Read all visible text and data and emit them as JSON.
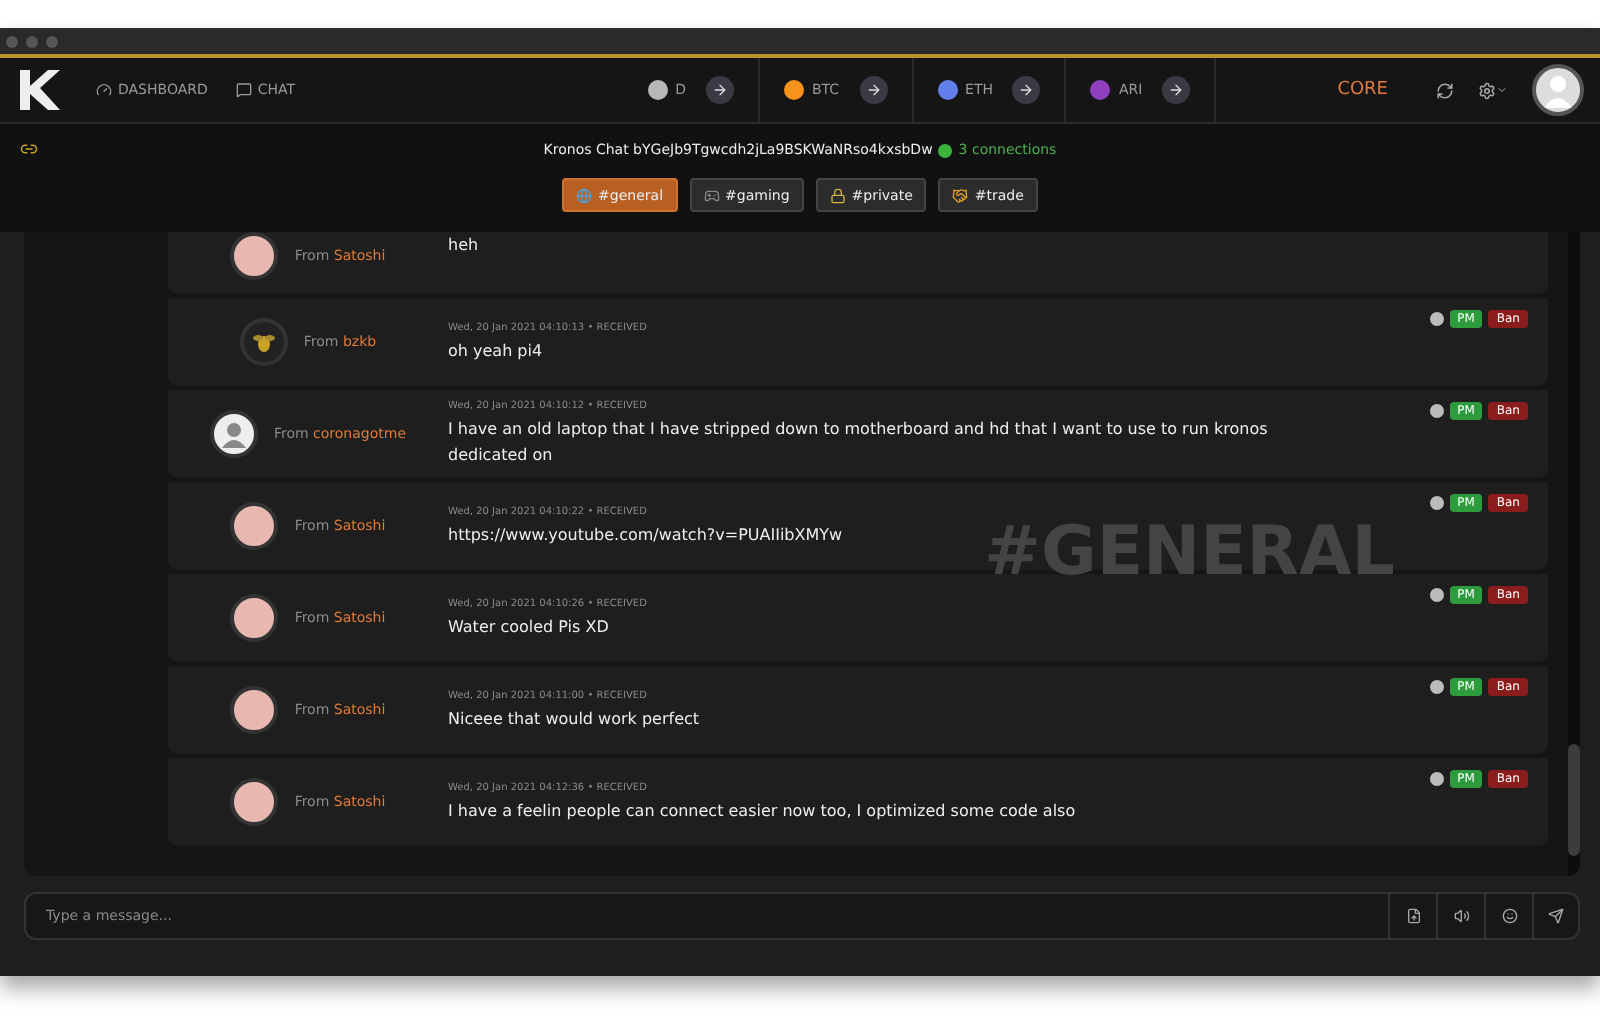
{
  "nav": {
    "links": [
      {
        "label": "DASHBOARD",
        "kind": "dashboard"
      },
      {
        "label": "CHAT",
        "kind": "chat"
      }
    ],
    "coins": [
      {
        "label": "D",
        "color": "#b8b8b8"
      },
      {
        "label": "BTC",
        "color": "#f7931a"
      },
      {
        "label": "ETH",
        "color": "#627eea"
      },
      {
        "label": "ARI",
        "color": "#8e3fc0"
      }
    ],
    "core": "CORE"
  },
  "chat": {
    "title": "Kronos Chat bYGeJb9Tgwcdh2jLa9BSKWaNRso4kxsbDw",
    "connections": "3 connections",
    "online": true,
    "channels": [
      {
        "label": "#general",
        "kind": "globe",
        "selected": true
      },
      {
        "label": "#gaming",
        "kind": "gamepad",
        "selected": false
      },
      {
        "label": "#private",
        "kind": "lock",
        "selected": false
      },
      {
        "label": "#trade",
        "kind": "handshake",
        "selected": false
      }
    ],
    "background_label": "#GENERAL",
    "messages": [
      {
        "from_label": "From",
        "sender": "Satoshi",
        "kind": "photo",
        "text": "heh"
      },
      {
        "from_label": "From",
        "sender": "bzkb",
        "kind": "bee",
        "time": "Wed, 20 Jan 2021 04:10:13 • RECEIVED",
        "text": "oh yeah pi4",
        "actions": [
          "PM",
          "Ban"
        ]
      },
      {
        "from_label": "From",
        "sender": "coronagotme",
        "kind": "silhouette",
        "time": "Wed, 20 Jan 2021 04:10:12 • RECEIVED",
        "text": "I have an old laptop that I have stripped down to motherboard and hd that I want to use to run kronos dedicated on",
        "actions": [
          "PM",
          "Ban"
        ]
      },
      {
        "from_label": "From",
        "sender": "Satoshi",
        "kind": "photo",
        "time": "Wed, 20 Jan 2021 04:10:22 • RECEIVED",
        "text": "https://www.youtube.com/watch?v=PUAIIibXMYw",
        "actions": [
          "PM",
          "Ban"
        ]
      },
      {
        "from_label": "From",
        "sender": "Satoshi",
        "kind": "photo",
        "time": "Wed, 20 Jan 2021 04:10:26 • RECEIVED",
        "text": "Water cooled Pis XD",
        "actions": [
          "PM",
          "Ban"
        ]
      },
      {
        "from_label": "From",
        "sender": "Satoshi",
        "kind": "photo",
        "time": "Wed, 20 Jan 2021 04:11:00 • RECEIVED",
        "text": "Niceee that would work perfect",
        "actions": [
          "PM",
          "Ban"
        ]
      },
      {
        "from_label": "From",
        "sender": "Satoshi",
        "kind": "photo",
        "time": "Wed, 20 Jan 2021 04:12:36 • RECEIVED",
        "text": "I have a feelin people can connect easier now too, I optimized some code also",
        "actions": [
          "PM",
          "Ban"
        ]
      }
    ],
    "input": {
      "placeholder": "Type a message..."
    }
  }
}
